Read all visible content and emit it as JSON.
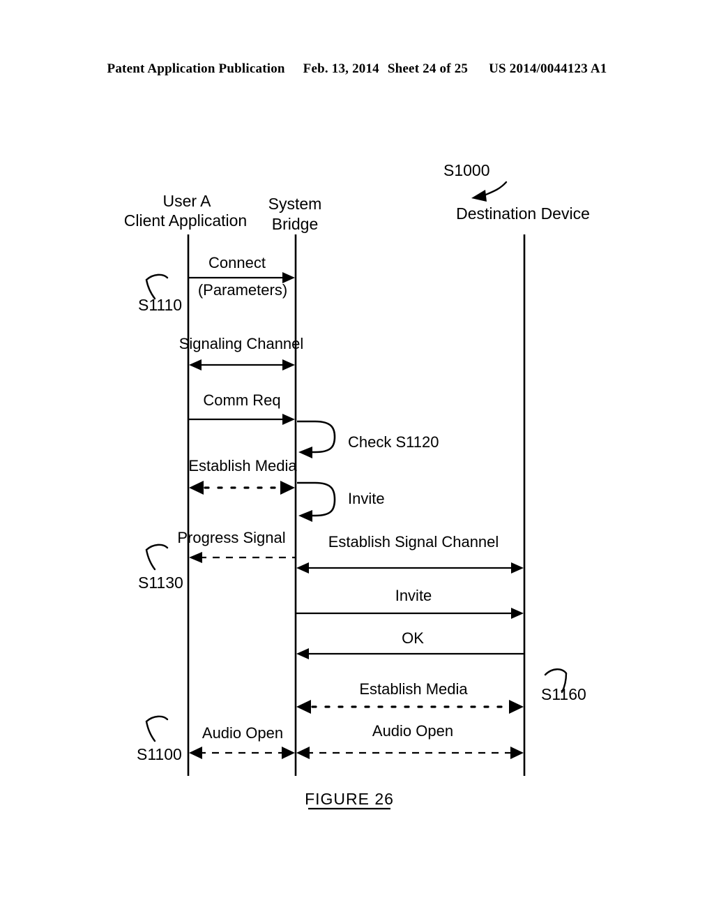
{
  "header": {
    "publication": "Patent Application Publication",
    "date": "Feb. 13, 2014",
    "sheet": "Sheet 24 of 25",
    "patent_number": "US 2014/0044123 A1"
  },
  "figure": {
    "caption": "FIGURE 26",
    "diagram_ref": "S1000"
  },
  "lifelines": [
    {
      "id": "client",
      "line1": "User A",
      "line2": "Client Application"
    },
    {
      "id": "bridge",
      "line1": "System",
      "line2": "Bridge"
    },
    {
      "id": "destination",
      "line1": "Destination Device",
      "line2": ""
    }
  ],
  "step_refs": [
    {
      "id": "s1000",
      "label": "S1000"
    },
    {
      "id": "s1110",
      "label": "S1110"
    },
    {
      "id": "s1130",
      "label": "S1130"
    },
    {
      "id": "s1160",
      "label": "S1160"
    },
    {
      "id": "s1100",
      "label": "S1100"
    }
  ],
  "messages": [
    {
      "id": "connect",
      "label": "Connect",
      "sublabel": "(Parameters)",
      "from": "client",
      "to": "bridge",
      "style": "solid",
      "direction": "right"
    },
    {
      "id": "signaling-channel",
      "label": "Signaling Channel",
      "from": "client",
      "to": "bridge",
      "style": "solid",
      "direction": "both"
    },
    {
      "id": "comm-req",
      "label": "Comm Req",
      "from": "client",
      "to": "bridge",
      "style": "solid",
      "direction": "right"
    },
    {
      "id": "check",
      "label": "Check S1120",
      "from": "bridge",
      "to": "bridge",
      "style": "self-loop",
      "direction": "self"
    },
    {
      "id": "establish-media-left",
      "label": "Establish Media",
      "from": "client",
      "to": "bridge",
      "style": "dotted",
      "direction": "both"
    },
    {
      "id": "invite-self",
      "label": "Invite",
      "from": "bridge",
      "to": "bridge",
      "style": "self-loop",
      "direction": "self"
    },
    {
      "id": "progress-signal",
      "label": "Progress Signal",
      "from": "bridge",
      "to": "client",
      "style": "dashed",
      "direction": "left"
    },
    {
      "id": "establish-signal-channel",
      "label": "Establish Signal Channel",
      "from": "bridge",
      "to": "destination",
      "style": "solid",
      "direction": "both"
    },
    {
      "id": "invite",
      "label": "Invite",
      "from": "bridge",
      "to": "destination",
      "style": "solid",
      "direction": "right"
    },
    {
      "id": "ok",
      "label": "OK",
      "from": "destination",
      "to": "bridge",
      "style": "solid",
      "direction": "left"
    },
    {
      "id": "establish-media-right",
      "label": "Establish Media",
      "from": "bridge",
      "to": "destination",
      "style": "dotted",
      "direction": "both"
    },
    {
      "id": "audio-open-left",
      "label": "Audio Open",
      "from": "client",
      "to": "bridge",
      "style": "dashed",
      "direction": "both"
    },
    {
      "id": "audio-open-right",
      "label": "Audio Open",
      "from": "bridge",
      "to": "destination",
      "style": "dashed",
      "direction": "both"
    }
  ],
  "colors": {
    "ink": "#000000",
    "background": "#ffffff"
  }
}
